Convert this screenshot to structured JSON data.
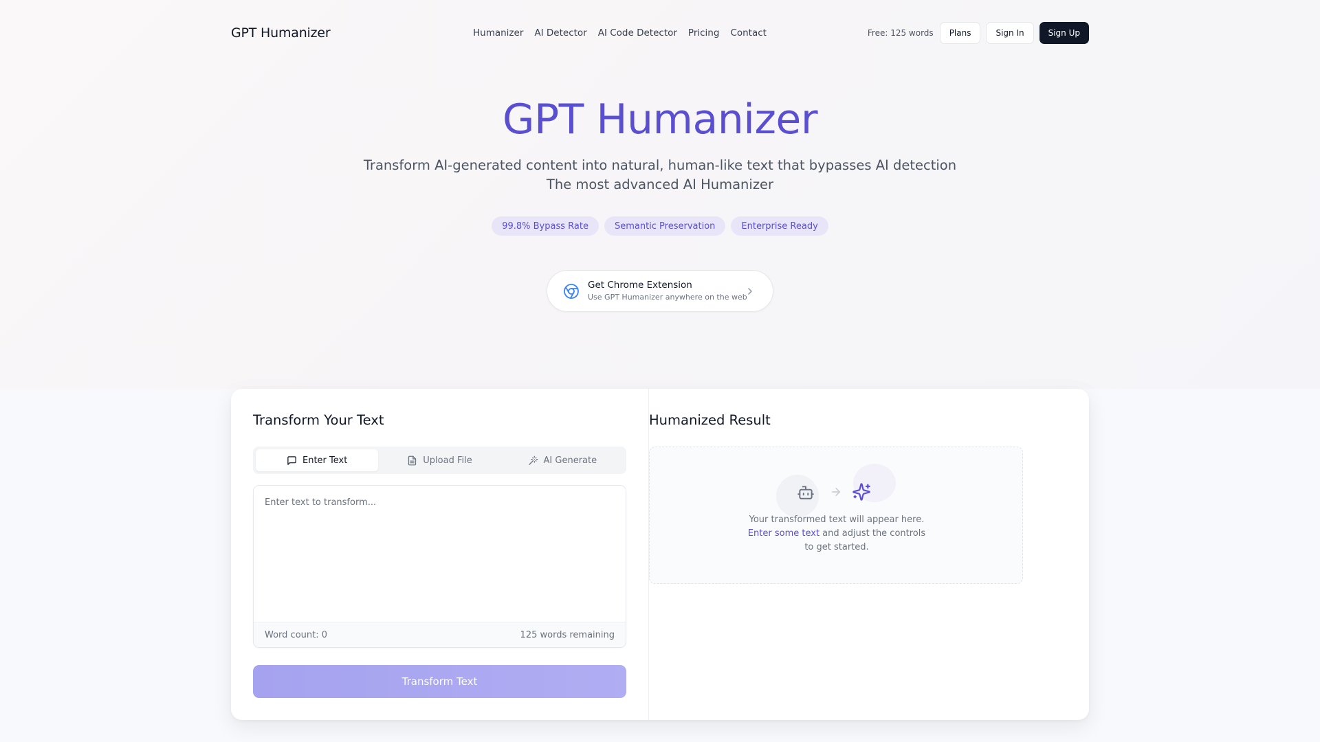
{
  "header": {
    "logo": "GPT Humanizer",
    "nav": [
      "Humanizer",
      "AI Detector",
      "AI Code Detector",
      "Pricing",
      "Contact"
    ],
    "free_words": "Free: 125 words",
    "plans_label": "Plans",
    "signin_label": "Sign In",
    "signup_label": "Sign Up"
  },
  "hero": {
    "title": "GPT Humanizer",
    "subtitle_line1": "Transform AI-generated content into natural, human-like text that bypasses AI detection",
    "subtitle_line2": "The most advanced AI Humanizer",
    "badges": [
      "99.8% Bypass Rate",
      "Semantic Preservation",
      "Enterprise Ready"
    ],
    "extension": {
      "title": "Get Chrome Extension",
      "description": "Use GPT Humanizer anywhere on the web"
    }
  },
  "transform": {
    "title": "Transform Your Text",
    "tabs": [
      {
        "label": "Enter Text",
        "icon": "message-square-icon",
        "active": true
      },
      {
        "label": "Upload File",
        "icon": "file-text-icon",
        "active": false
      },
      {
        "label": "AI Generate",
        "icon": "wand-icon",
        "active": false
      }
    ],
    "input_placeholder": "Enter text to transform...",
    "word_count": "Word count: 0",
    "words_remaining": "125 words remaining",
    "button_label": "Transform Text"
  },
  "result": {
    "title": "Humanized Result",
    "empty_line1": "Your transformed text will appear here.",
    "empty_link": "Enter some text",
    "empty_line2_rest": " and adjust the controls",
    "empty_line3": "to get started."
  },
  "colors": {
    "accent": "#5b4fd1",
    "badge_bg": "#e9e5f8",
    "dark_button": "#101828",
    "transform_button": "#a5a2ef"
  }
}
